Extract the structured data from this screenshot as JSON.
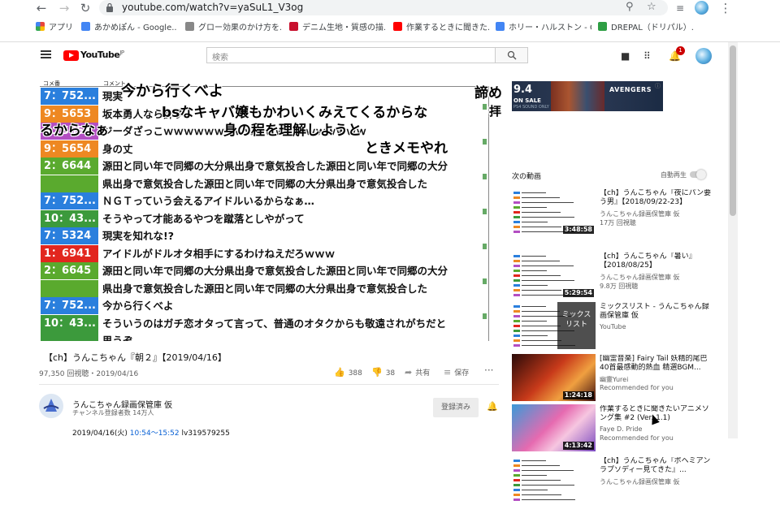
{
  "browser": {
    "url": "youtube.com/watch?v=yaSuL1_V3og",
    "bookmarks": [
      {
        "label": "アプリ",
        "color": "#e8453c"
      },
      {
        "label": "あかめぽん - Google...",
        "color": "#4285f4"
      },
      {
        "label": "グロー効果のかけ方を...",
        "color": "#888888"
      },
      {
        "label": "デニム生地・質感の描...",
        "color": "#c8102e"
      },
      {
        "label": "作業するときに聞きた...",
        "color": "#ff0000"
      },
      {
        "label": "ホリー・ハルストン - Go...",
        "color": "#4285f4"
      },
      {
        "label": "DREPAL（ドリパル）...",
        "color": "#2e9e44"
      }
    ]
  },
  "youtube": {
    "logo_text": "YouTube",
    "logo_region": "JP",
    "search_placeholder": "検索",
    "notification_count": "1"
  },
  "player": {
    "col_num_label": "コメ番",
    "col_comment_label": "コメント",
    "rows": [
      {
        "num": "7：752...",
        "color": "#2a7fdd",
        "text": "現実"
      },
      {
        "num": "9：5653",
        "color": "#ee8822",
        "text": "坂本勇人なら許す"
      },
      {
        "num": "4：5651",
        "color": "#b34ec2",
        "text": "ジーダざっこｗｗｗｗｗｗｗｗｗｗｗｗｗｗｗｗｗｗｗｗ"
      },
      {
        "num": "9：5654",
        "color": "#ee8822",
        "text": "身の丈"
      },
      {
        "num": "2：6644",
        "color": "#5aaa2e",
        "text": "源田と同い年で同郷の大分県出身で意気投合した源田と同い年で同郷の大分"
      },
      {
        "num": "",
        "color": "#5aaa2e",
        "text": "県出身で意気投合した源田と同い年で同郷の大分県出身で意気投合した"
      },
      {
        "num": "7：752...",
        "color": "#2a7fdd",
        "text": "ＮＧＴっていう会えるアイドルいるからなぁ…"
      },
      {
        "num": "10：43...",
        "color": "#3c9a3c",
        "text": "そうやって才能あるやつを蹴落としやがって"
      },
      {
        "num": "7：5324",
        "color": "#2a7fdd",
        "text": "現実を知れな!?"
      },
      {
        "num": "1：6941",
        "color": "#e2261e",
        "text": "アイドルがドルオタ相手にするわけねえだろｗｗｗ"
      },
      {
        "num": "2：6645",
        "color": "#5aaa2e",
        "text": "源田と同い年で同郷の大分県出身で意気投合した源田と同い年で同郷の大分"
      },
      {
        "num": "",
        "color": "#5aaa2e",
        "text": "県出身で意気投合した源田と同い年で同郷の大分県出身で意気投合した"
      },
      {
        "num": "7：752...",
        "color": "#2a7fdd",
        "text": "今から行くべよ"
      },
      {
        "num": "10：43...",
        "color": "#3c9a3c",
        "text": "そういうのはガチ恋オタって言って、普通のオタクからも敬遠されがちだと"
      },
      {
        "num": "",
        "color": "#3c9a3c",
        "text": "思うぞ"
      }
    ],
    "overlays": [
      "今から行くべよ",
      "bsなキャバ嬢もかわいくみえてくるからな",
      "るからなぁ",
      "身の程を理解しようと",
      "ときメモやれ",
      "諦め",
      "拝"
    ]
  },
  "video": {
    "title": "【ch】うんこちゃん『朝２』【2019/04/16】",
    "views": "97,350 回視聴・2019/04/16",
    "likes": "388",
    "dislikes": "38",
    "share": "共有",
    "save": "保存"
  },
  "channel": {
    "name": "うんこちゃん録画保管庫 仮",
    "subscribers": "チャンネル登録者数 14万人",
    "subscribe_label": "登録済み",
    "desc_date": "2019/04/16(火) ",
    "desc_time": "10:54～15:52",
    "desc_rest": " lv319579255"
  },
  "ad": {
    "score": "9.4",
    "label": "ON SALE",
    "platform": "PS4 SOUND ONLY",
    "game": "AVENGERS"
  },
  "sidebar": {
    "next_label": "次の動画",
    "autoplay_label": "自動再生",
    "videos": [
      {
        "title": "【ch】うんこちゃん『夜にパン要う男』【2018/09/22-23】",
        "channel": "うんこちゃん録画保管庫 仮",
        "meta": "17万 回視聴",
        "duration": "3:48:58",
        "thumb": "comments"
      },
      {
        "title": "【ch】うんこちゃん『暑い』【2018/08/25】",
        "channel": "うんこちゃん録画保管庫 仮",
        "meta": "9.8万 回視聴",
        "duration": "5:29:54",
        "thumb": "comments"
      },
      {
        "title": "ミックスリスト - うんこちゃん録画保管庫 仮",
        "channel": "YouTube",
        "meta": "",
        "duration": "",
        "thumb": "mix",
        "mix_label": "ミックス\nリスト"
      },
      {
        "title": "[幽霊音楽] Fairy Tail 妖精的尾巴 40首最感動的熱血 精選BGM...",
        "channel": "幽靈Yurei",
        "meta": "Recommended for you",
        "duration": "1:24:18",
        "thumb": "anime_red"
      },
      {
        "title": "作業するときに聞きたいアニメソング集 #2 (Ver. 1.1)",
        "channel": "Faye D. Pride",
        "meta": "Recommended for you",
        "duration": "4:13:42",
        "thumb": "anime_pink"
      },
      {
        "title": "【ch】うんこちゃん『ボヘミアンラプソディー見てきた』...",
        "channel": "うんこちゃん録画保管庫 仮",
        "meta": "",
        "duration": "",
        "thumb": "comments"
      }
    ]
  }
}
